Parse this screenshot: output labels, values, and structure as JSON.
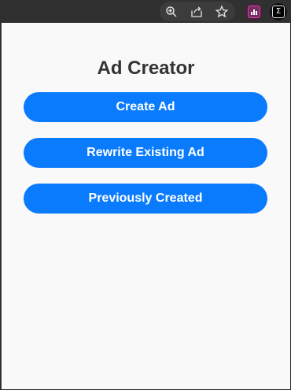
{
  "browser": {
    "toolbar_icons": [
      "zoom-icon",
      "share-icon",
      "star-icon"
    ],
    "extensions": [
      {
        "name": "analytics-extension-icon"
      },
      {
        "name": "sigma-extension-icon",
        "glyph": "Σ"
      }
    ]
  },
  "popup": {
    "title": "Ad Creator",
    "buttons": {
      "create": "Create Ad",
      "rewrite": "Rewrite Existing Ad",
      "previous": "Previously Created"
    }
  },
  "colors": {
    "button_bg": "#0a7bfd",
    "button_text": "#ffffff",
    "title_text": "#333333",
    "popup_bg": "#f9f9fa"
  }
}
